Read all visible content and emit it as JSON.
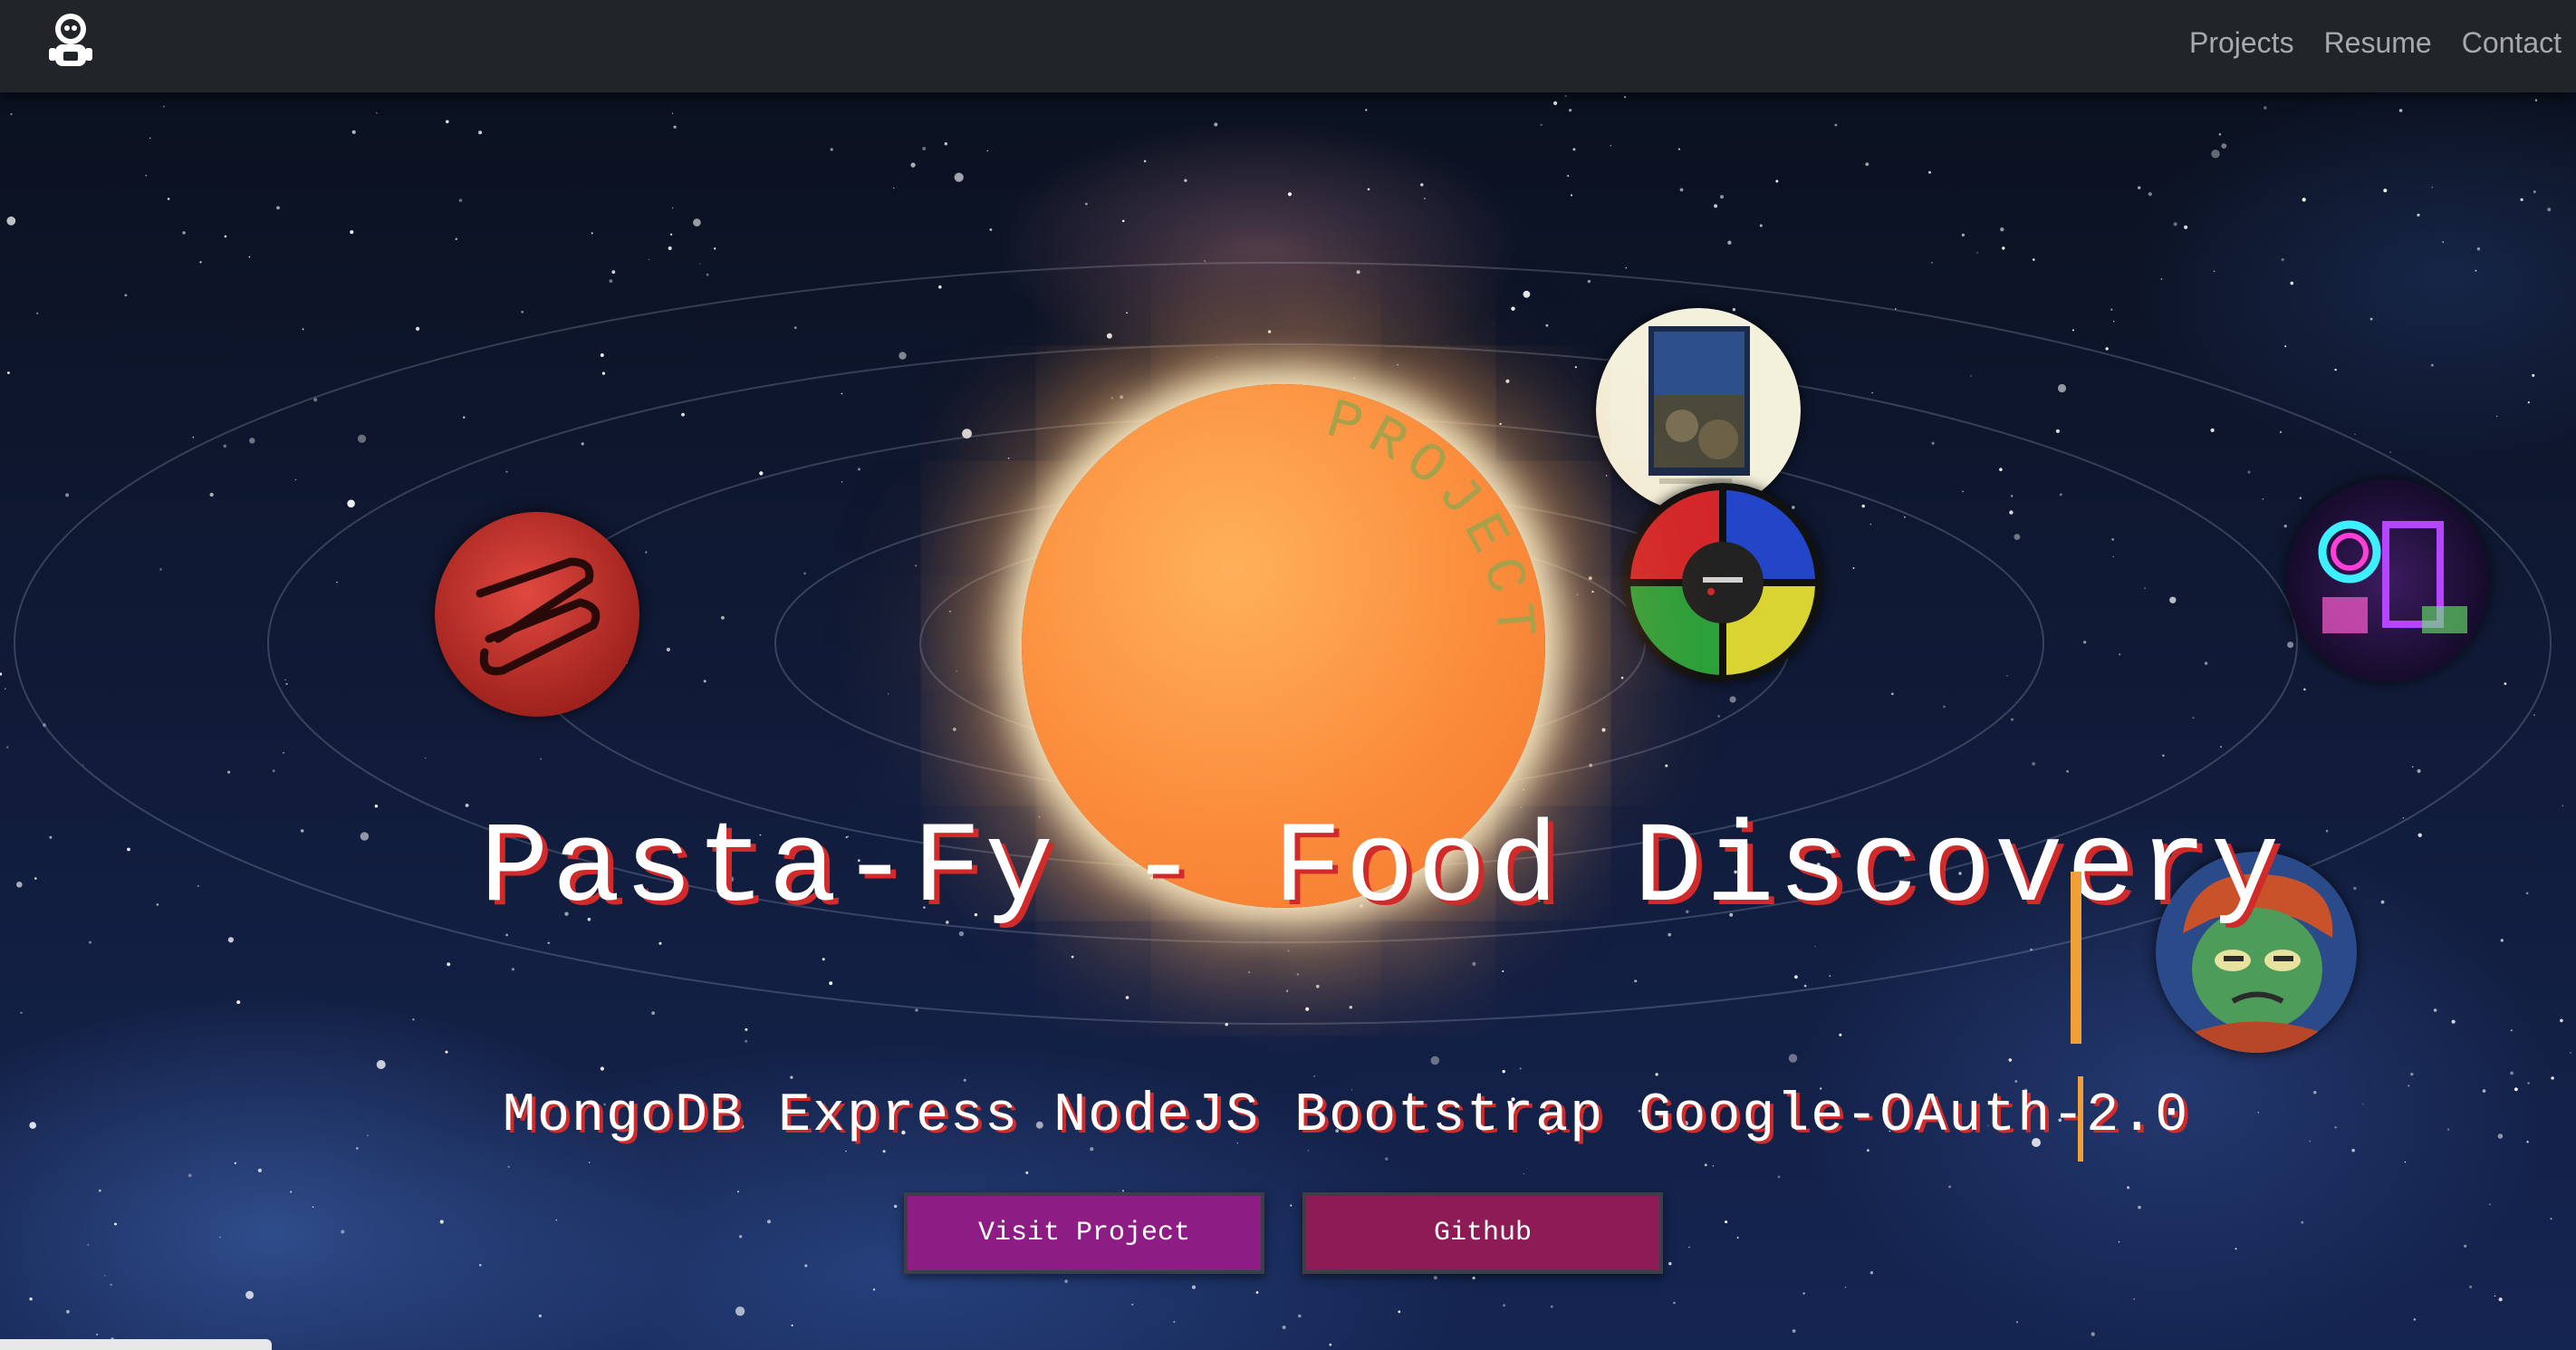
{
  "navbar": {
    "logo_icon": "astronaut-icon",
    "links": [
      {
        "label": "Projects"
      },
      {
        "label": "Resume"
      },
      {
        "label": "Contact"
      }
    ],
    "background": "#212429",
    "link_color": "#a6a9ad"
  },
  "hero": {
    "sun_label": "PROJECTS",
    "project_title": "Pasta-Fy - Food Discovery",
    "project_tech": "MongoDB Express NodeJS Bootstrap Google-OAuth-2.0",
    "buttons": {
      "visit_label": "Visit Project",
      "github_label": "Github"
    },
    "planets": [
      {
        "icon": "red-logo-planet-icon"
      },
      {
        "icon": "photo-thumbnail-planet-icon"
      },
      {
        "icon": "simon-game-planet-icon"
      },
      {
        "icon": "pc-rgb-planet-icon"
      },
      {
        "icon": "zombie-avatar-planet-icon"
      }
    ],
    "colors": {
      "sun": "#fb8d3d",
      "title_shadow": "#d12a2a",
      "cursor": "#f1a037",
      "visit_button": "#8d1d85",
      "github_button": "#8d1b56"
    }
  }
}
